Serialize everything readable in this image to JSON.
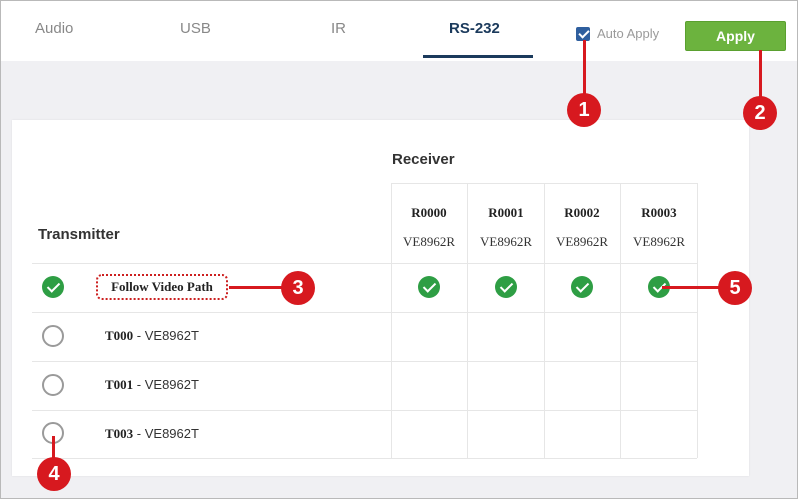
{
  "tabs": [
    {
      "label": "Audio",
      "active": false
    },
    {
      "label": "USB",
      "active": false
    },
    {
      "label": "IR",
      "active": false
    },
    {
      "label": "RS-232",
      "active": true
    }
  ],
  "toolbar": {
    "auto_apply_label": "Auto Apply",
    "auto_apply_checked": true,
    "apply_label": "Apply"
  },
  "table": {
    "receiver_title": "Receiver",
    "transmitter_title": "Transmitter",
    "receivers": [
      {
        "code": "R0000",
        "model": "VE8962R"
      },
      {
        "code": "R0001",
        "model": "VE8962R"
      },
      {
        "code": "R0002",
        "model": "VE8962R"
      },
      {
        "code": "R0003",
        "model": "VE8962R"
      }
    ],
    "rows": [
      {
        "label": "Follow Video Path",
        "selected": true,
        "receivers_checked": [
          true,
          true,
          true,
          true
        ]
      },
      {
        "code": "T000",
        "separator": " - ",
        "model": "VE8962T",
        "selected": false
      },
      {
        "code": "T001",
        "separator": " - ",
        "model": "VE8962T",
        "selected": false
      },
      {
        "code": "T003",
        "separator": " - ",
        "model": "VE8962T",
        "selected": false
      }
    ]
  },
  "callouts": [
    "1",
    "2",
    "3",
    "4",
    "5"
  ],
  "colors": {
    "active_tab": "#1b3a5c",
    "apply_button": "#6cb33e",
    "check_green": "#2e9e44",
    "callout_red": "#d7191f",
    "background_grey": "#f0f0f3"
  }
}
